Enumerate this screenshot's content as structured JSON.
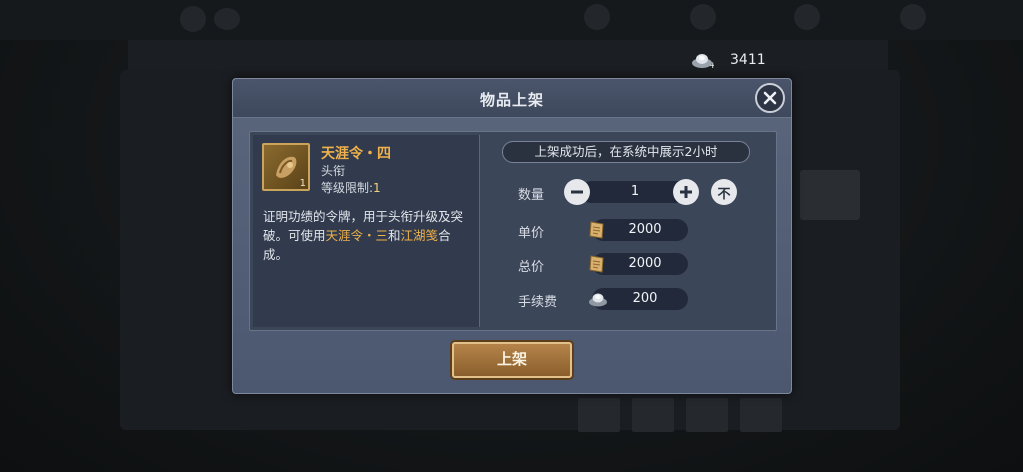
{
  "currency": {
    "icon": "silver-ingot-icon",
    "amount": "3411"
  },
  "dialog": {
    "title": "物品上架",
    "close_icon": "close-icon",
    "item": {
      "icon": "token-icon",
      "count": "1",
      "name": "天涯令・四",
      "type": "头衔",
      "level_label": "等级限制:",
      "level_value": "1",
      "desc_1": "证明功绩的令牌，用于头衔升级及突破。可使用",
      "desc_hl_1": "天涯令・三",
      "desc_2": "和",
      "desc_hl_2": "江湖笺",
      "desc_3": "合成。"
    },
    "notice": "上架成功后，在系统中展示2小时",
    "quantity": {
      "label": "数量",
      "value": "1",
      "minus_icon": "minus-icon",
      "plus_icon": "plus-icon",
      "max_icon": "max-icon",
      "max_label": "不"
    },
    "unit_price": {
      "label": "单价",
      "icon": "ticket-icon",
      "value": "2000"
    },
    "total_price": {
      "label": "总价",
      "icon": "ticket-icon",
      "value": "2000"
    },
    "fee": {
      "label": "手续费",
      "icon": "silver-ingot-icon",
      "value": "200"
    },
    "confirm_label": "上架"
  },
  "colors": {
    "accent_gold": "#f0b24a",
    "panel": "#4c5870",
    "button": "#b5844a"
  }
}
